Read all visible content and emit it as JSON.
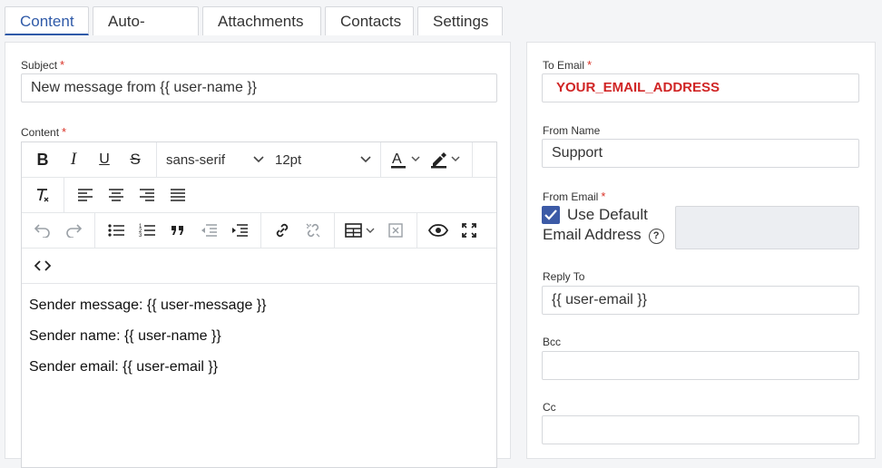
{
  "tabs": [
    {
      "label": "Content",
      "active": true
    },
    {
      "label": "Auto-Reply"
    },
    {
      "label": "Attachments"
    },
    {
      "label": "Contacts"
    },
    {
      "label": "Settings"
    }
  ],
  "left": {
    "subject_label": "Subject",
    "subject_value": "New message from {{ user-name }}",
    "content_label": "Content",
    "toolbar": {
      "font_family": "sans-serif",
      "font_size": "12pt"
    },
    "body_lines": [
      "Sender message: {{ user-message }}",
      "Sender name: {{ user-name }}",
      "Sender email: {{ user-email }}"
    ]
  },
  "right": {
    "to_email_label": "To Email",
    "to_email_value": "YOUR_EMAIL_ADDRESS",
    "from_name_label": "From Name",
    "from_name_value": "Support",
    "from_email_label": "From Email",
    "use_default_line1": "Use Default",
    "use_default_line2": "Email Address",
    "help_glyph": "?",
    "reply_to_label": "Reply To",
    "reply_to_value": "{{ user-email }}",
    "bcc_label": "Bcc",
    "bcc_value": "",
    "cc_label": "Cc",
    "cc_value": ""
  },
  "required_mark": "*",
  "colors": {
    "accent": "#2f5aa8",
    "required": "#d93025",
    "checkbox": "#3c5aa6",
    "placeholder_red": "#d02525"
  }
}
